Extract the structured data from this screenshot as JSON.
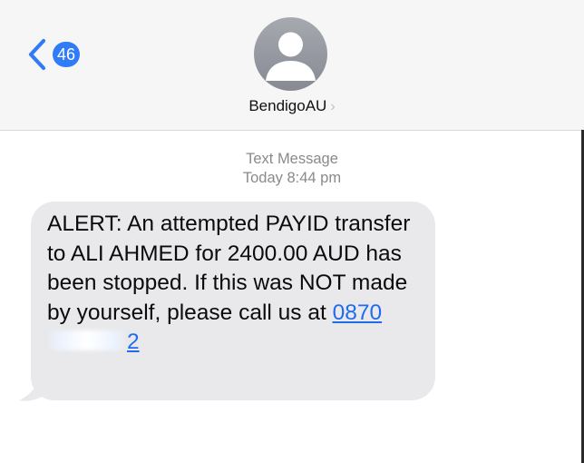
{
  "nav": {
    "back_icon": "chevron-left-icon",
    "unread_count": "46"
  },
  "contact": {
    "name": "BendigoAU",
    "chevron": "›",
    "avatar_icon": "person-silhouette-icon"
  },
  "thread": {
    "label": "Text Message",
    "timestamp": "Today 8:44 pm"
  },
  "message": {
    "text": "ALERT: An attempted PAYID transfer to ALI AHMED for 2400.00 AUD has been stopped. If this was NOT made by yourself, please call us at ",
    "phone_visible_start": "0870",
    "phone_visible_end": "2"
  },
  "colors": {
    "accent": "#2f7cf6",
    "link": "#1f6cf0",
    "bubble": "#e9e9eb",
    "header_bg": "#f6f6f6",
    "meta_text": "#8a8a8e"
  }
}
